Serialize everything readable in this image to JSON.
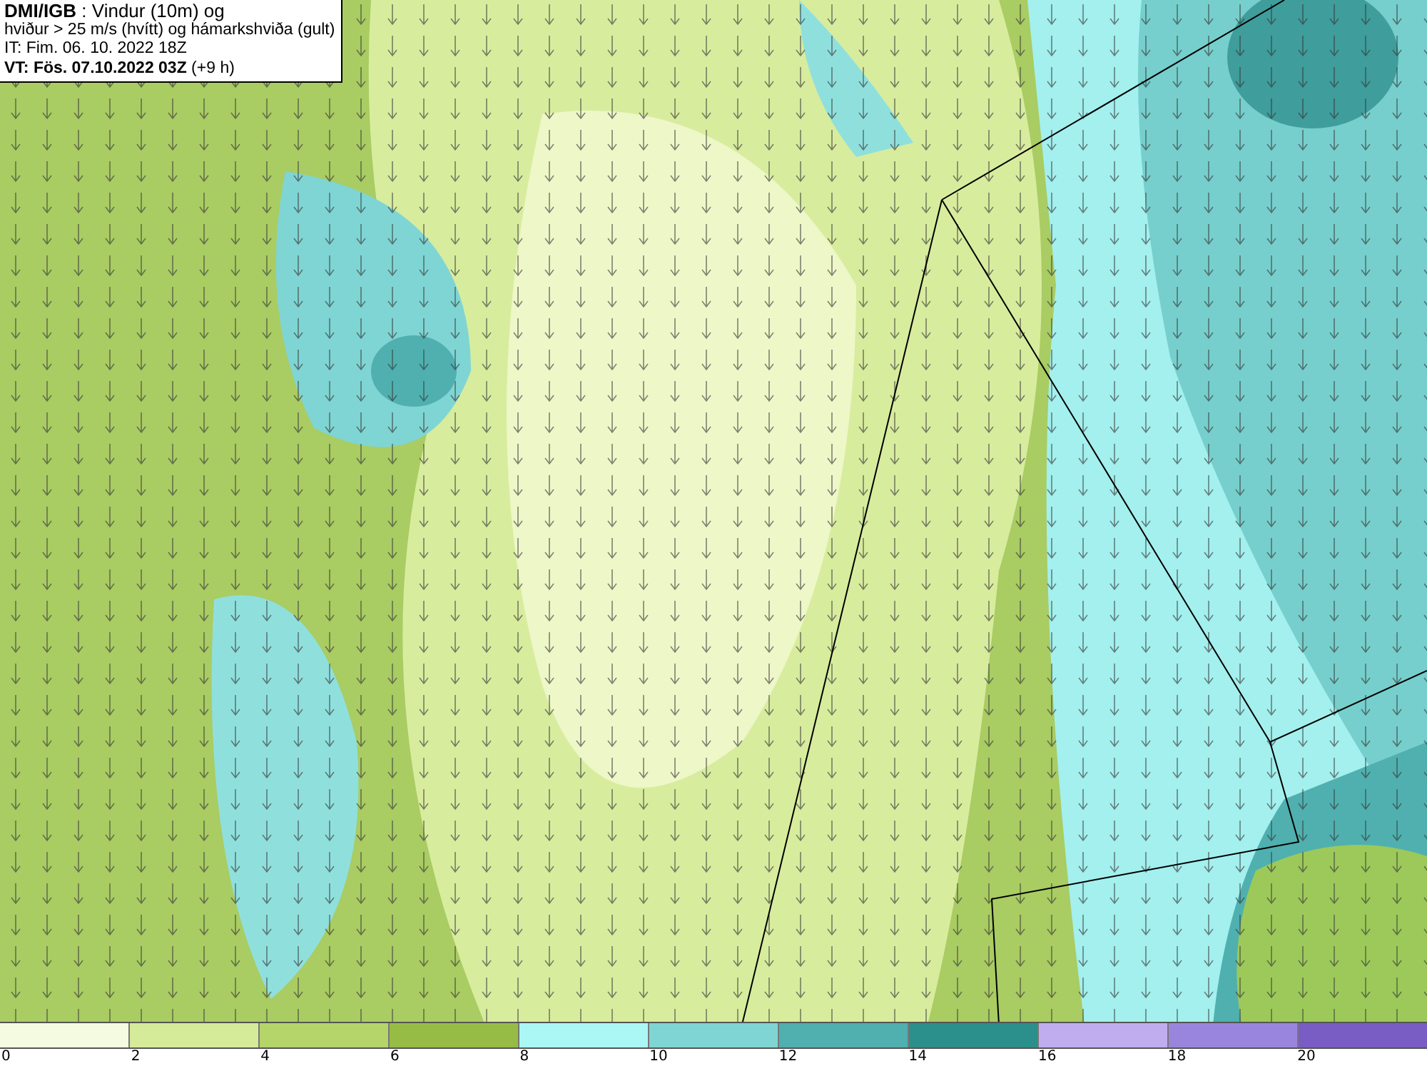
{
  "info_box": {
    "lines": [
      "**DMI/IGB** : Vindur (10m) og",
      "hviður > 25 m/s (hvítt) og hámarkshviða (gult)",
      "IT: Fim. 06. 10. 2022 18Z",
      "**VT: Fös. 07.10.2022 03Z** (+9 h)"
    ]
  },
  "legend": {
    "segments": [
      {
        "color": "#f5fbe0"
      },
      {
        "color": "#d6eb9a"
      },
      {
        "color": "#b5d46a"
      },
      {
        "color": "#97bc45"
      },
      {
        "color": "#aaf7f5"
      },
      {
        "color": "#7fd5d3"
      },
      {
        "color": "#4fb0af"
      },
      {
        "color": "#2b8f8c"
      },
      {
        "color": "#c0adf0"
      },
      {
        "color": "#9a85dc"
      },
      {
        "color": "#7a5dc4"
      }
    ],
    "ticks": [
      "0",
      "2",
      "4",
      "6",
      "8",
      "10",
      "12",
      "14",
      "16",
      "18",
      "20"
    ]
  }
}
